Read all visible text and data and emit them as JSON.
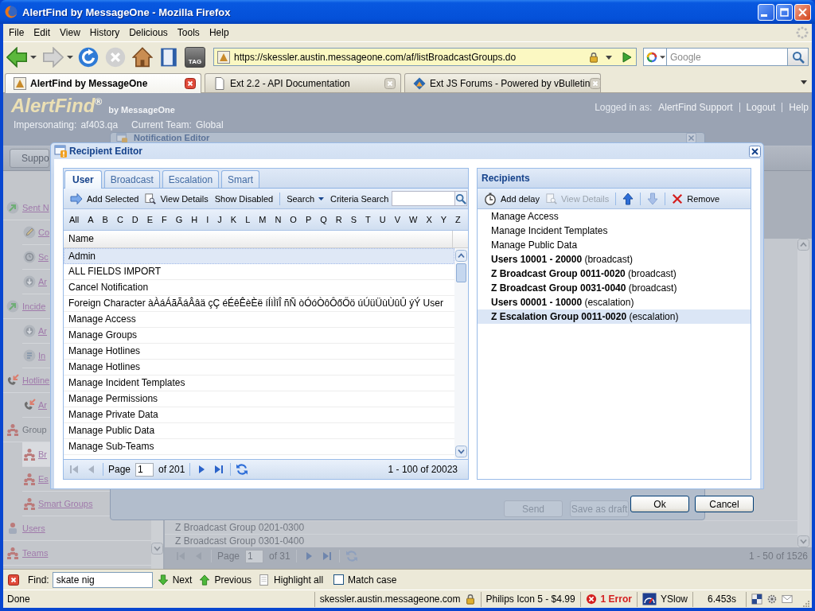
{
  "window": {
    "title": "AlertFind by MessageOne - Mozilla Firefox"
  },
  "menu": [
    "File",
    "Edit",
    "View",
    "History",
    "Delicious",
    "Tools",
    "Help"
  ],
  "navigation": {
    "tag_button": "TAG"
  },
  "address_bar": {
    "url": "https://skessler.austin.messageone.com/af/listBroadcastGroups.do",
    "secure": true
  },
  "search_bar": {
    "placeholder": "Google"
  },
  "tabs": [
    {
      "label": "AlertFind by MessageOne",
      "selected": true
    },
    {
      "label": "Ext 2.2 - API Documentation",
      "selected": false
    },
    {
      "label": "Ext JS Forums - Powered by vBulletin",
      "selected": false
    }
  ],
  "page": {
    "logo": "AlertFind$^{®}$",
    "logo_byline": "by MessageOne",
    "impersonating": {
      "label": "Impersonating:",
      "value": "af403.qa"
    },
    "team": {
      "label": "Current Team:",
      "value": "Global"
    },
    "account": {
      "label": "Logged in as:",
      "user": "AlertFind Support",
      "links": [
        "Logout",
        "Help"
      ]
    },
    "toolbar_button": "Suppo",
    "sidebar": [
      {
        "label": "Sent N",
        "kind": "link",
        "selected": false,
        "children": [
          {
            "label": "Co",
            "selected": false
          },
          {
            "label": "Sc",
            "selected": false
          },
          {
            "label": "Ar",
            "selected": false
          }
        ]
      },
      {
        "label": "Incide",
        "kind": "link",
        "selected": false,
        "children": [
          {
            "label": "Ar",
            "selected": false
          },
          {
            "label": "In",
            "selected": false
          }
        ]
      },
      {
        "label": "Hotline",
        "kind": "link",
        "selected": false,
        "children": [
          {
            "label": "Ar",
            "selected": false
          }
        ]
      },
      {
        "label": "Group",
        "kind": "heading",
        "selected": false,
        "children": [
          {
            "label": "Br",
            "selected": true
          },
          {
            "label": "Es",
            "selected": false
          },
          {
            "label": "Smart Groups",
            "selected": false
          }
        ]
      },
      {
        "label": "Users",
        "kind": "link",
        "selected": false
      },
      {
        "label": "Teams",
        "kind": "link",
        "selected": false
      }
    ],
    "notification_editor": {
      "title": "Notification Editor",
      "buttons": [
        "Send",
        "Save as draft"
      ]
    },
    "grid": {
      "rows": [
        "Z Broadcast Group 0201-0300",
        "Z Broadcast Group 0301-0400"
      ],
      "pager": {
        "nav": [
          {
            "kind": "first",
            "disabled": true
          },
          {
            "kind": "prev",
            "disabled": true
          },
          {
            "kind": "next",
            "disabled": false
          },
          {
            "kind": "last",
            "disabled": false
          }
        ],
        "page_label": "Page",
        "page": "1",
        "page_count": "of 31",
        "summary": "1 - 50 of 1526"
      }
    }
  },
  "recipient_editor": {
    "title": "Recipient Editor",
    "tabs": [
      {
        "label": "User",
        "selected": true
      },
      {
        "label": "Broadcast",
        "selected": false
      },
      {
        "label": "Escalation",
        "selected": false
      },
      {
        "label": "Smart",
        "selected": false
      }
    ],
    "toolbar": {
      "add_selected": "Add Selected",
      "view_details": "View Details",
      "show_disabled": "Show Disabled",
      "search": "Search",
      "criteria_search": "Criteria Search"
    },
    "letters": [
      "All",
      "A",
      "B",
      "C",
      "D",
      "E",
      "F",
      "G",
      "H",
      "I",
      "J",
      "K",
      "L",
      "M",
      "N",
      "O",
      "P",
      "Q",
      "R",
      "S",
      "T",
      "U",
      "V",
      "W",
      "X",
      "Y",
      "Z"
    ],
    "grid": {
      "columns": [
        "Name"
      ],
      "rows": [
        {
          "name": "Admin",
          "selected": true
        },
        {
          "name": "ALL FIELDS IMPORT",
          "selected": false
        },
        {
          "name": "Cancel Notification",
          "selected": false
        },
        {
          "name": "Foreign Character àÀáÁãÃáÂâä çÇ éÉêÊèÈë íÍìÌîÎ ñÑ òÓóÒôÔőŐö úÚüÜùÙûÛ ýÝ User",
          "selected": false
        },
        {
          "name": "Manage Access",
          "selected": false
        },
        {
          "name": "Manage Groups",
          "selected": false
        },
        {
          "name": "Manage Hotlines",
          "selected": false
        },
        {
          "name": "Manage Hotlines",
          "selected": false
        },
        {
          "name": "Manage Incident Templates",
          "selected": false
        },
        {
          "name": "Manage Permissions",
          "selected": false
        },
        {
          "name": "Manage Private Data",
          "selected": false
        },
        {
          "name": "Manage Public Data",
          "selected": false
        },
        {
          "name": "Manage Sub-Teams",
          "selected": false
        }
      ]
    },
    "pager": {
      "nav": [
        {
          "kind": "first",
          "disabled": true
        },
        {
          "kind": "prev",
          "disabled": true
        },
        {
          "kind": "next",
          "disabled": false
        },
        {
          "kind": "last",
          "disabled": false
        }
      ],
      "page_label": "Page",
      "page": "1",
      "page_count": "of 201",
      "summary": "1 - 100 of 20023"
    },
    "recipients": {
      "title": "Recipients",
      "toolbar": {
        "add_delay": "Add delay",
        "view_details": {
          "label": "View Details",
          "disabled": true
        },
        "move_up": {
          "disabled": false
        },
        "move_down": {
          "disabled": true
        },
        "remove": "Remove"
      },
      "items": [
        {
          "label": "Manage Access",
          "selected": false
        },
        {
          "label": "Manage Incident Templates",
          "selected": false
        },
        {
          "label": "Manage Public Data",
          "selected": false
        },
        {
          "label": "**Users 10001 - 20000** (broadcast)",
          "selected": false
        },
        {
          "label": "**Z Broadcast Group 0011-0020** (broadcast)",
          "selected": false
        },
        {
          "label": "**Z Broadcast Group 0031-0040** (broadcast)",
          "selected": false
        },
        {
          "label": "**Users 00001 - 10000** (escalation)",
          "selected": false
        },
        {
          "label": "**Z Escalation Group 0011-0020** (escalation)",
          "selected": true
        }
      ]
    },
    "buttons": [
      "Ok",
      "Cancel"
    ]
  },
  "find_bar": {
    "label": "Find:",
    "value": "skate nig",
    "next": "Next",
    "previous": "Previous",
    "highlight_all": "Highlight all",
    "match_case": {
      "label": "Match case",
      "checked": false
    }
  },
  "status_bar": {
    "text": "Done",
    "host": "skessler.austin.messageone.com",
    "addon": "Philips Icon 5 - $4.99",
    "errors": "1 Error",
    "yslow": "YSlow",
    "load_time": "6.453s"
  }
}
